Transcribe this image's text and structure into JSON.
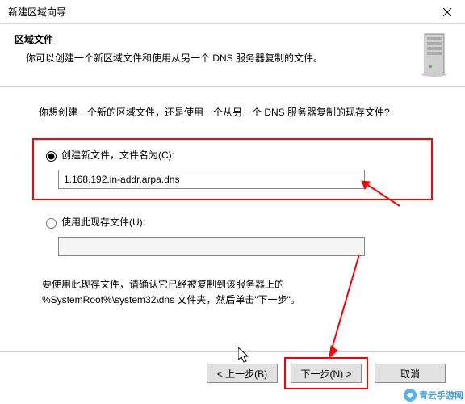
{
  "titlebar": {
    "text": "新建区域向导"
  },
  "header": {
    "title": "区域文件",
    "subtitle": "你可以创建一个新区域文件和使用从另一个 DNS 服务器复制的文件。"
  },
  "body": {
    "question": "你想创建一个新的区域文件，还是使用一个从另一个 DNS 服务器复制的现存文件?",
    "option_create_label": "创建新文件，文件名为(C):",
    "create_filename": "1.168.192.in-addr.arpa.dns",
    "option_existing_label": "使用此现存文件(U):",
    "existing_filename": "",
    "note_line1": "要使用此现存文件，请确认它已经被复制到该服务器上的",
    "note_line2": "%SystemRoot%\\system32\\dns 文件夹，然后单击\"下一步\"。"
  },
  "buttons": {
    "back": "< 上一步(B)",
    "next": "下一步(N) >",
    "cancel": "取消"
  },
  "watermark": {
    "text": "青云手游网"
  }
}
